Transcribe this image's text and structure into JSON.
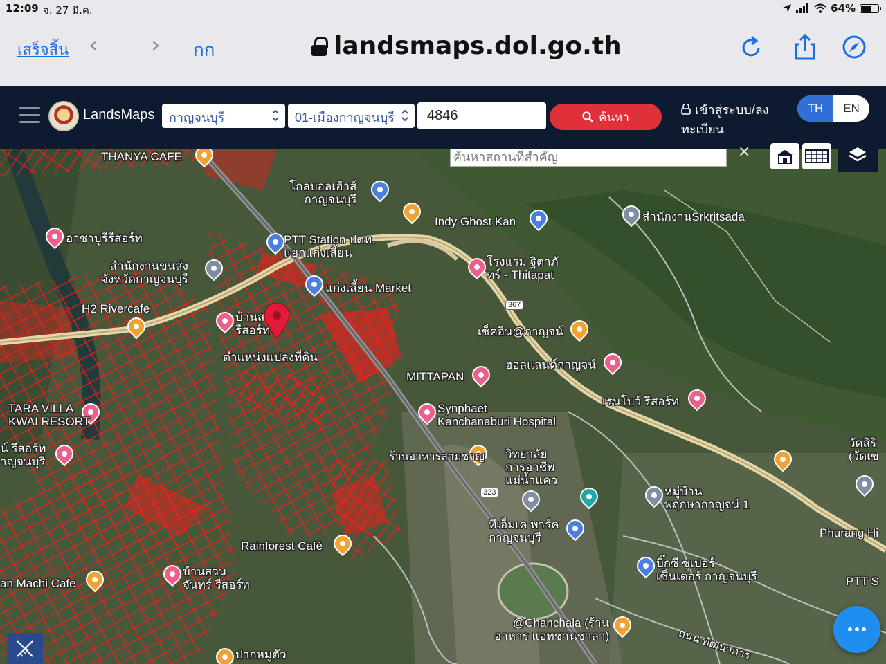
{
  "status_bar": {
    "time": "12:09",
    "date": "จ. 27 มี.ค.",
    "battery": "64%",
    "battery_level": 0.64
  },
  "browser": {
    "done_label": "เสร็จสิ้น",
    "text_size_label": "กก",
    "url": "landsmaps.dol.go.th",
    "icons": [
      "back-icon",
      "forward-icon",
      "lock-icon",
      "reload-icon",
      "share-icon",
      "compass-icon"
    ]
  },
  "header": {
    "logo_text": "LandsMaps",
    "province_select": "กาญจนบุรี",
    "district_select": "01-เมืองกาญจนบุรี",
    "parcel_number": "4846",
    "search_label": "ค้นหา",
    "login_label": "เข้าสู่ระบบ/ลงทะเบียน",
    "lang_th": "TH",
    "lang_en": "EN",
    "active_lang": "TH"
  },
  "map": {
    "place_search_placeholder": "ค้นหาสถานที่สำคัญ",
    "clear_label": "×",
    "labels": {
      "thanya_cafe": "THANYA CAFE",
      "football": "โกลบอลเฮ้าส์\nกาญจนบุรี",
      "indy": "Indy Ghost Kan",
      "srkritsada": "สำนักงานSrkritsada",
      "acharin": "อาชาบูรีรีสอร์ท",
      "ptt": "PTT Station ปตท.\nแยกแก่งเสี้ยน",
      "transport": "สำนักงานขนส่ง\nจังหวัดกาญจนบุรี",
      "thitapat": "โรงแรม ฐิตาภั\nทร์ - Thitapat",
      "market": "แก่งเสี้ยน Market",
      "rivercafe": "H2 Rivercafe",
      "resort_near_marker": "บ้านสวน\nรีสอร์ท",
      "checkin": "เช็คอิน@กาญจน์",
      "parcel_position": "ตำแหน่งแปลงที่ดิน",
      "hollanda": "ฮอลแลนด์กาญจน์",
      "mittapan": "MITTAPAN",
      "rainbow": "เรนโบว์ รีสอร์ท",
      "tara": "TARA VILLA\nKWAI RESORT",
      "synphaet": "Synphaet\nKanchanaburi Hospital",
      "resort_left": "น์ รีสอร์ท\nาญจนบุรี",
      "restaurant": "ร้านอาหารสามชาญ",
      "college": "วิทยาลัย\nการอาชีพ\nแม่น้ำแคว",
      "watsi": "วัดสิริ\n(วัดเข",
      "village": "หมู่บ้าน\nพฤกษากาญจน์ 1",
      "tmt": "ทีเอ็มเค พาร์ค\nกาญจนบุรี",
      "phurang": "Phurang Hi",
      "rainforest": "Rainforest Café",
      "machi": "an Machi Cafe",
      "baansuan": "บ้านสวน\nจันทร์ รีสอร์ท",
      "bigc": "บิ๊กซี ซูเปอร์\nเซ็นเตอร์ กาญจนบุรี",
      "ptt_right": "PTT S",
      "chanchala": "@Chanchala (ร้าน\nอาหาร แอทชานชาลา)",
      "pakkrong": "ปากหมูตัว",
      "pattana": "ถนน พัฒนาการ"
    },
    "routes": {
      "r367": "367",
      "r323": "323"
    }
  },
  "colors": {
    "header_bg": "#0e1a2f",
    "search_red": "#e0303a",
    "lang_blue": "#2f6fd6",
    "parcel_red": "#ff1a1a",
    "link_blue": "#1a6fe0"
  }
}
